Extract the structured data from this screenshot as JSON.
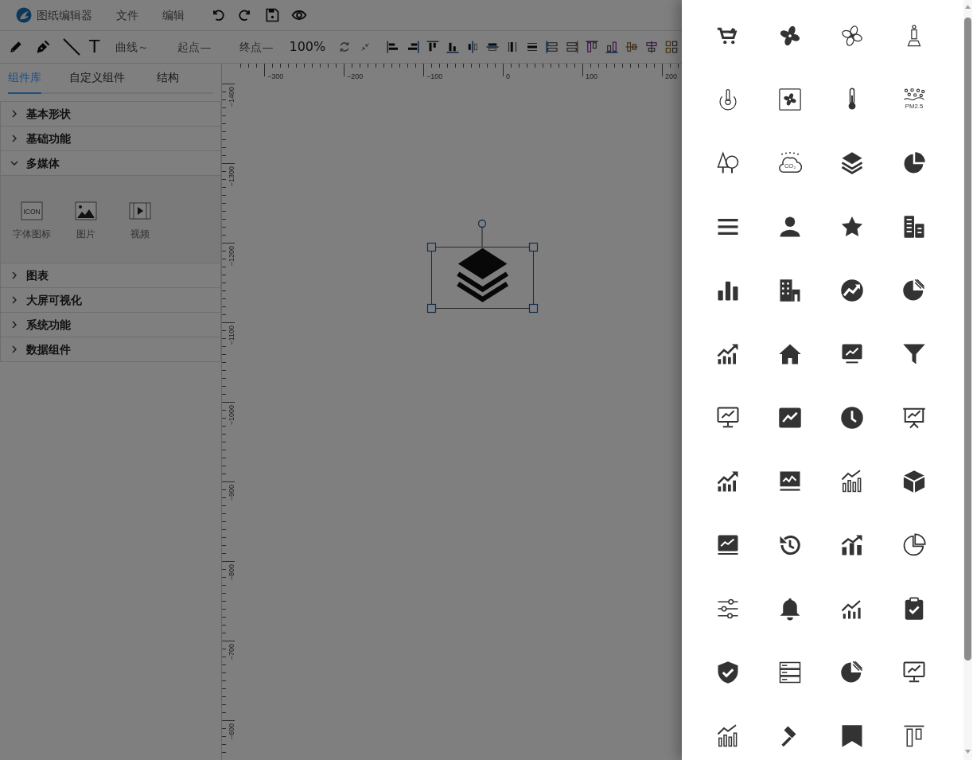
{
  "header": {
    "title": "图纸编辑器",
    "menus": [
      "文件",
      "编辑"
    ]
  },
  "toolbar": {
    "text_tool": "T",
    "options": [
      "曲线～",
      "起点—",
      "终点—"
    ],
    "zoom": "100%"
  },
  "panel": {
    "tabs": [
      {
        "label": "组件库",
        "selected": true
      },
      {
        "label": "自定义组件",
        "selected": false
      },
      {
        "label": "结构",
        "selected": false
      }
    ],
    "sections": [
      {
        "label": "基本形状",
        "expanded": false
      },
      {
        "label": "基础功能",
        "expanded": false
      },
      {
        "label": "多媒体",
        "expanded": true,
        "items": [
          {
            "label": "字体图标",
            "kind": "font-icon",
            "icon_text": "ICON"
          },
          {
            "label": "图片",
            "kind": "image"
          },
          {
            "label": "视频",
            "kind": "video"
          }
        ]
      },
      {
        "label": "图表",
        "expanded": false
      },
      {
        "label": "大屏可视化",
        "expanded": false
      },
      {
        "label": "系统功能",
        "expanded": false
      },
      {
        "label": "数据组件",
        "expanded": false
      }
    ]
  },
  "ruler": {
    "x_labels": [
      "−300",
      "−200",
      "−100",
      "0",
      "100",
      "200"
    ],
    "y_labels": [
      "−1400",
      "−1300",
      "−1200",
      "−1100",
      "−1000",
      "−900",
      "−800",
      "−700",
      "−600"
    ]
  },
  "canvas": {
    "element": {
      "kind": "layers",
      "selected": true
    }
  },
  "drawer": {
    "icons": [
      {
        "kind": "cart"
      },
      {
        "kind": "fan"
      },
      {
        "kind": "fan-outline"
      },
      {
        "kind": "person-stand"
      },
      {
        "kind": "temp-cycle"
      },
      {
        "kind": "fan-box"
      },
      {
        "kind": "thermometer"
      },
      {
        "kind": "pm25",
        "label": "PM2.5"
      },
      {
        "kind": "trees"
      },
      {
        "kind": "co2",
        "label": "CO₂"
      },
      {
        "kind": "layers"
      },
      {
        "kind": "pie"
      },
      {
        "kind": "menu"
      },
      {
        "kind": "user"
      },
      {
        "kind": "star"
      },
      {
        "kind": "buildings"
      },
      {
        "kind": "bar-chart"
      },
      {
        "kind": "building"
      },
      {
        "kind": "trend-circle"
      },
      {
        "kind": "pie-split"
      },
      {
        "kind": "growth-chart"
      },
      {
        "kind": "home"
      },
      {
        "kind": "monitor-chart"
      },
      {
        "kind": "filter"
      },
      {
        "kind": "monitor-line"
      },
      {
        "kind": "chart-square"
      },
      {
        "kind": "clock"
      },
      {
        "kind": "presentation"
      },
      {
        "kind": "growth-chart"
      },
      {
        "kind": "monitor-wave"
      },
      {
        "kind": "bar-trend"
      },
      {
        "kind": "cube"
      },
      {
        "kind": "monitor-box"
      },
      {
        "kind": "history"
      },
      {
        "kind": "bar-up"
      },
      {
        "kind": "pie-outline"
      },
      {
        "kind": "sliders"
      },
      {
        "kind": "bell"
      },
      {
        "kind": "trend-small"
      },
      {
        "kind": "clipboard-check"
      },
      {
        "kind": "shield-check"
      },
      {
        "kind": "server"
      },
      {
        "kind": "pie-split"
      },
      {
        "kind": "monitor-line"
      },
      {
        "kind": "bar-trend"
      },
      {
        "kind": "hammer"
      },
      {
        "kind": "bookmark"
      },
      {
        "kind": "align-top"
      }
    ]
  }
}
